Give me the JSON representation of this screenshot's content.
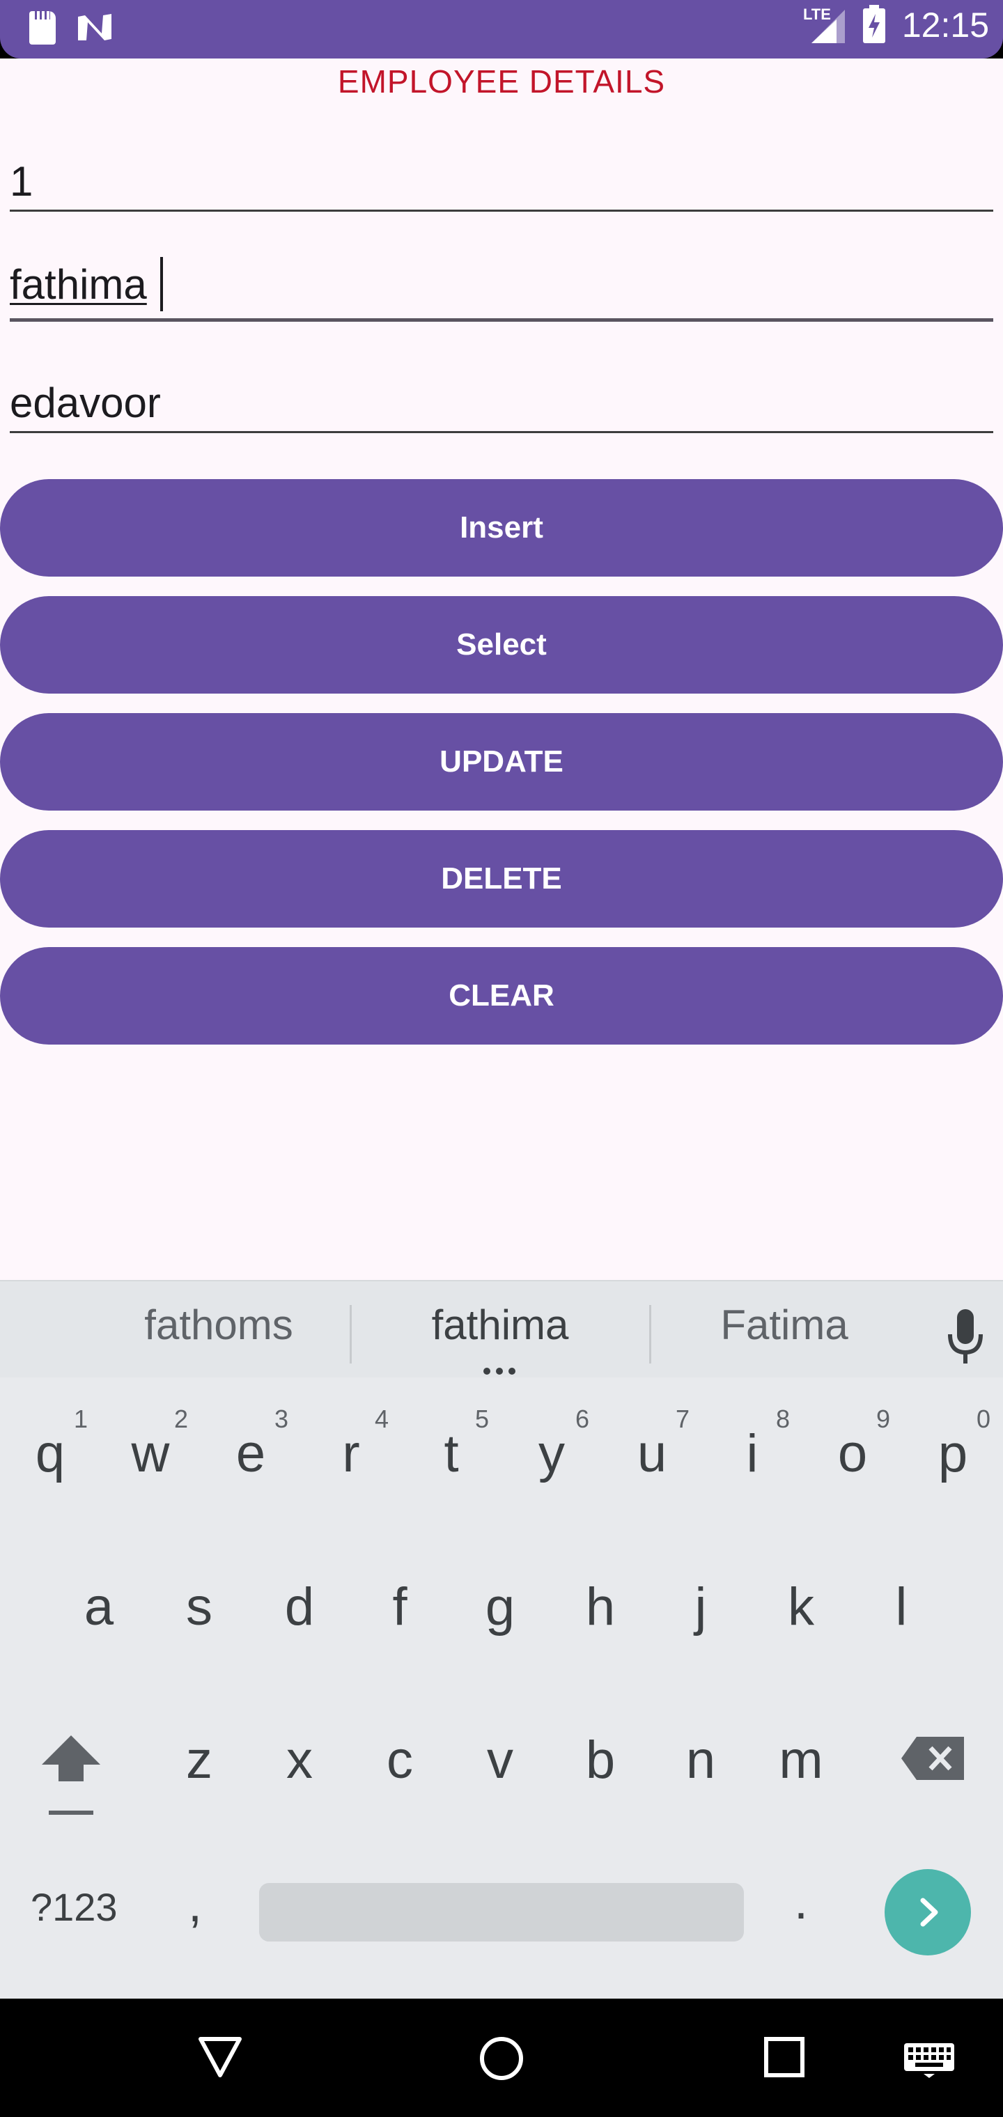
{
  "status_bar": {
    "clock": "12:15",
    "network": "LTE",
    "icons": [
      "sd-card-icon",
      "n-notification-icon",
      "signal-icon",
      "battery-icon"
    ]
  },
  "app": {
    "title": "EMPLOYEE DETAILS",
    "fields": [
      {
        "name": "employee-id-field",
        "value": "1"
      },
      {
        "name": "employee-name-field",
        "value": "fathima"
      },
      {
        "name": "employee-address-field",
        "value": "edavoor"
      }
    ],
    "buttons": {
      "insert": "Insert",
      "select": "Select",
      "update": "UPDATE",
      "delete": "DELETE",
      "clear": "CLEAR"
    },
    "accent": "#6750A4",
    "title_color": "#C2152A"
  },
  "keyboard": {
    "suggestions": [
      "fathoms",
      "fathima",
      "Fatima"
    ],
    "row1": [
      "q",
      "w",
      "e",
      "r",
      "t",
      "y",
      "u",
      "i",
      "o",
      "p"
    ],
    "row1_nums": [
      "1",
      "2",
      "3",
      "4",
      "5",
      "6",
      "7",
      "8",
      "9",
      "0"
    ],
    "row2": [
      "a",
      "s",
      "d",
      "f",
      "g",
      "h",
      "j",
      "k",
      "l"
    ],
    "row3": [
      "z",
      "x",
      "c",
      "v",
      "b",
      "n",
      "m"
    ],
    "symbols_label": "?123",
    "comma": ",",
    "period": ".",
    "enter_color": "#4DB6AC"
  },
  "nav_bar": {
    "icons": [
      "back-icon",
      "home-icon",
      "recents-icon",
      "keyboard-switch-icon"
    ]
  }
}
